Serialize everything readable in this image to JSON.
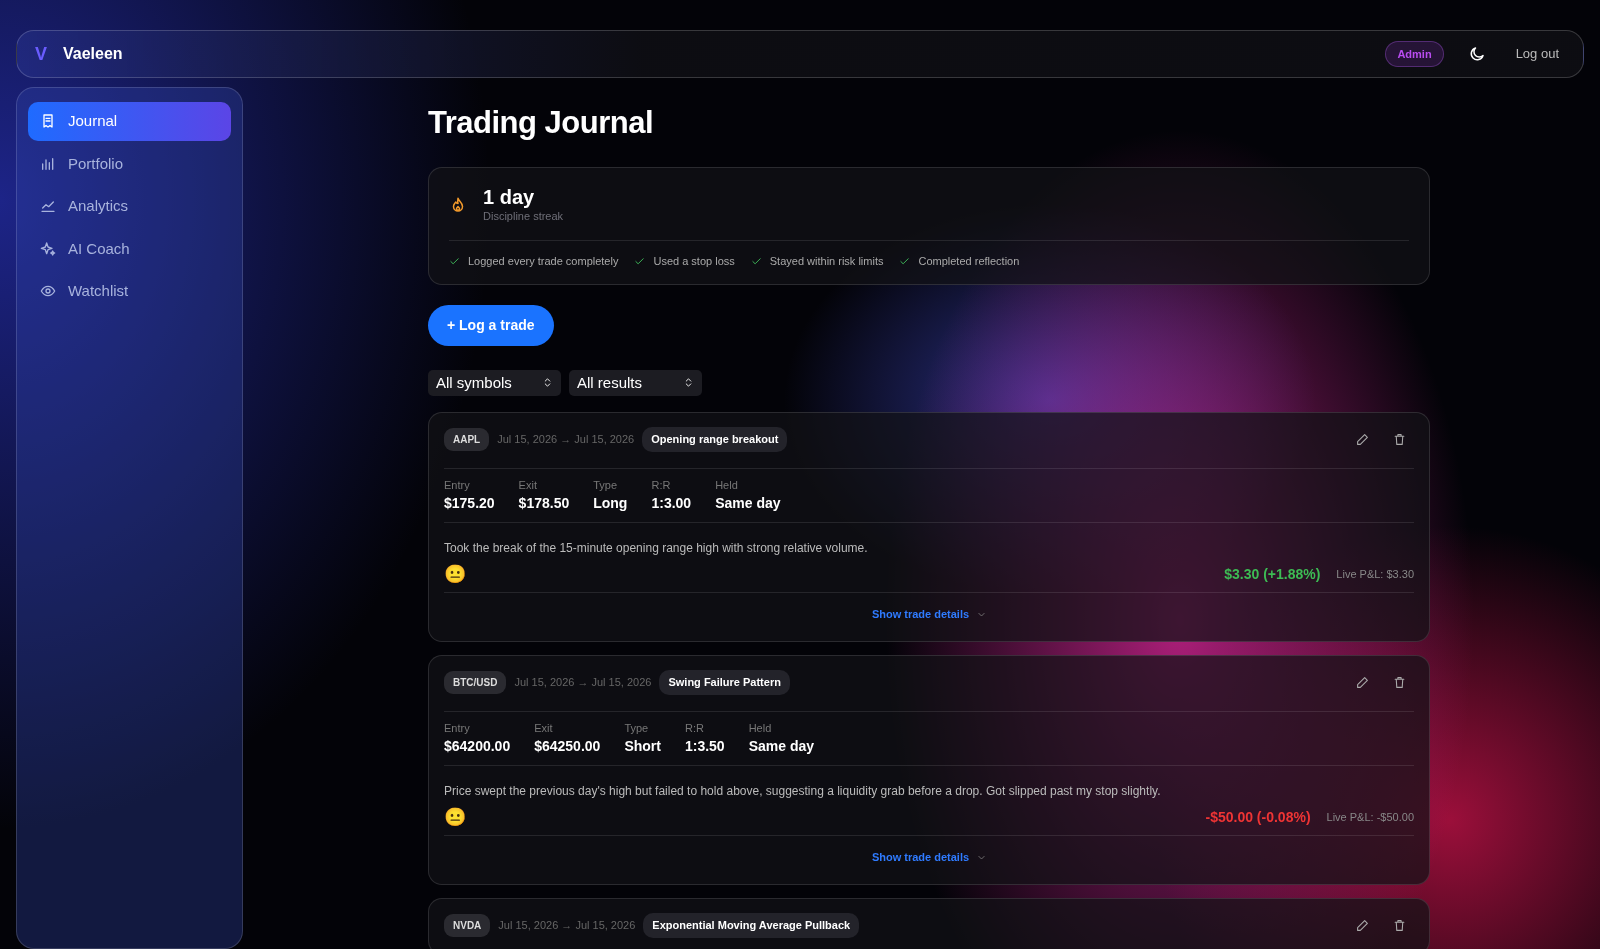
{
  "brand": {
    "mark": "V",
    "name": "Vaeleen"
  },
  "header": {
    "role_badge": "Admin",
    "logout": "Log out"
  },
  "sidebar": {
    "items": [
      {
        "label": "Journal",
        "selected": true
      },
      {
        "label": "Portfolio",
        "selected": false
      },
      {
        "label": "Analytics",
        "selected": false
      },
      {
        "label": "AI Coach",
        "selected": false
      },
      {
        "label": "Watchlist",
        "selected": false
      }
    ]
  },
  "page_title": "Trading Journal",
  "streak": {
    "value": "1 day",
    "label": "Discipline streak",
    "checks": [
      {
        "label": "Logged every trade completely",
        "checked": true
      },
      {
        "label": "Used a stop loss",
        "checked": true
      },
      {
        "label": "Stayed within risk limits",
        "checked": true
      },
      {
        "label": "Completed reflection",
        "checked": true
      }
    ]
  },
  "log_button": "+ Log a trade",
  "filters": [
    {
      "value": "All symbols"
    },
    {
      "value": "All results"
    }
  ],
  "trades": [
    {
      "symbol": "AAPL",
      "dates": "Jul 15, 2026 → Jul 15, 2026",
      "strategy": "Opening range breakout",
      "stats": [
        {
          "label": "Entry",
          "value": "$175.20"
        },
        {
          "label": "Exit",
          "value": "$178.50"
        },
        {
          "label": "Type",
          "value": "Long"
        },
        {
          "label": "R:R",
          "value": "1:3.00"
        },
        {
          "label": "Held",
          "value": "Same day"
        }
      ],
      "note": "Took the break of the 15-minute opening range high with strong relative volume.",
      "mood": "😐",
      "kind": "win",
      "pnl": "$3.30 (+1.88%)",
      "live_pnl": "Live P&L: $3.30",
      "details_link": "Show trade details"
    },
    {
      "symbol": "BTC/USD",
      "dates": "Jul 15, 2026 → Jul 15, 2026",
      "strategy": "Swing Failure Pattern",
      "stats": [
        {
          "label": "Entry",
          "value": "$64200.00"
        },
        {
          "label": "Exit",
          "value": "$64250.00"
        },
        {
          "label": "Type",
          "value": "Short"
        },
        {
          "label": "R:R",
          "value": "1:3.50"
        },
        {
          "label": "Held",
          "value": "Same day"
        }
      ],
      "note": "Price swept the previous day's high but failed to hold above, suggesting a liquidity grab before a drop. Got slipped past my stop slightly.",
      "mood": "😐",
      "kind": "loss",
      "pnl": "-$50.00 (-0.08%)",
      "live_pnl": "Live P&L: -$50.00",
      "details_link": "Show trade details"
    },
    {
      "symbol": "NVDA",
      "dates": "Jul 15, 2026 → Jul 15, 2026",
      "strategy": "Exponential Moving Average Pullback"
    }
  ]
}
